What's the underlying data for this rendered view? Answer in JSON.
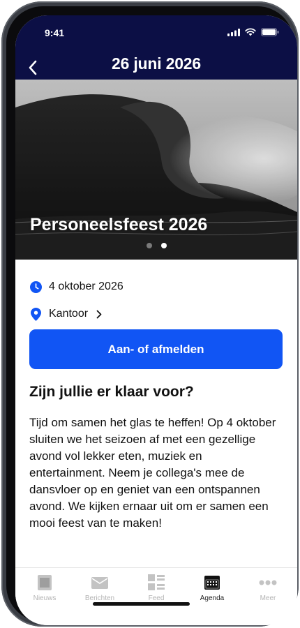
{
  "status_bar": {
    "time": "9:41",
    "icons": [
      "signal-icon",
      "wifi-icon",
      "battery-icon"
    ]
  },
  "header": {
    "title": "26 juni 2026",
    "back_icon": "back-chevron-icon"
  },
  "hero": {
    "title": "Personeelsfeest 2026",
    "image": "ocean-wave-photo",
    "carousel": {
      "pages": 2,
      "active_page": 2
    }
  },
  "event": {
    "date": "4 oktober 2026",
    "location": "Kantoor",
    "cta_label": "Aan- of afmelden",
    "heading": "Zijn jullie er klaar voor?",
    "description": "Tijd om samen het glas te heffen! Op 4 oktober sluiten we het seizoen af met een gezellige avond vol lekker eten, muziek en entertainment. Neem je collega's mee de dansvloer op en geniet van een ontspannen avond. We kijken ernaar uit om er samen een mooi feest van te maken!"
  },
  "tabbar": {
    "items": [
      {
        "label": "Nieuws",
        "icon": "news-icon",
        "active": false
      },
      {
        "label": "Berichten",
        "icon": "messages-icon",
        "active": false
      },
      {
        "label": "Feed",
        "icon": "feed-icon",
        "active": false
      },
      {
        "label": "Agenda",
        "icon": "calendar-icon",
        "active": true
      },
      {
        "label": "Meer",
        "icon": "more-icon",
        "active": false
      }
    ]
  },
  "colors": {
    "header_bg": "#0c0f45",
    "accent": "#1155f4",
    "tab_inactive": "#b4b4b4",
    "tab_active": "#222222"
  }
}
